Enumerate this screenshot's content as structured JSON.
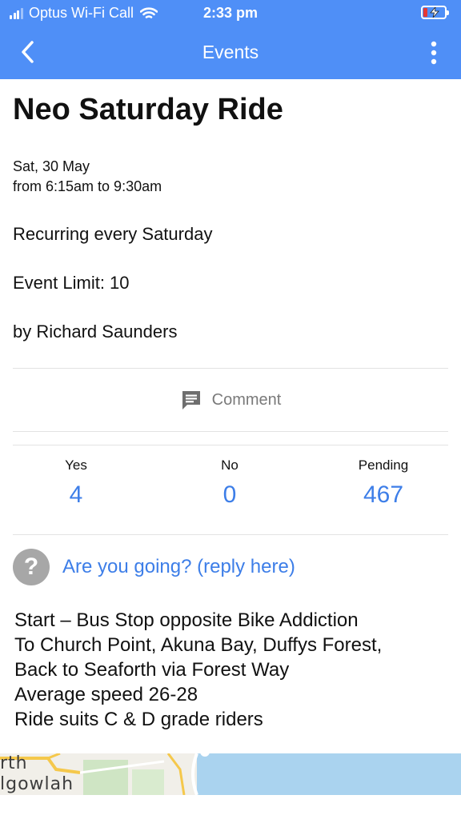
{
  "status_bar": {
    "carrier": "Optus Wi-Fi Call",
    "time": "2:33 pm",
    "battery_level": "low-charging"
  },
  "app_bar": {
    "title": "Events",
    "back_icon": "chevron-left-icon",
    "more_icon": "more-vertical-icon"
  },
  "event": {
    "title": "Neo Saturday Ride",
    "date": "Sat, 30 May",
    "time_range": "from 6:15am to 9:30am",
    "recurring": "Recurring every Saturday",
    "limit": "Event Limit: 10",
    "organizer": "by Richard Saunders"
  },
  "comment": {
    "icon": "comment-icon",
    "label": "Comment"
  },
  "rsvp": {
    "yes_label": "Yes",
    "yes_count": "4",
    "no_label": "No",
    "no_count": "0",
    "pending_label": "Pending",
    "pending_count": "467"
  },
  "going_prompt": {
    "icon": "question-icon",
    "text": "Are you going? (reply here)"
  },
  "description": [
    "Start – Bus Stop opposite Bike Addiction",
    "To Church Point, Akuna Bay, Duffys Forest,",
    "Back to Seaforth via Forest Way",
    "Average speed 26-28",
    "Ride suits C & D grade riders"
  ],
  "map": {
    "label_1": "rth",
    "label_2": "lgowlah"
  },
  "colors": {
    "accent": "#4f8ff7",
    "link": "#3d7ee8",
    "muted": "#7a7a7a"
  }
}
